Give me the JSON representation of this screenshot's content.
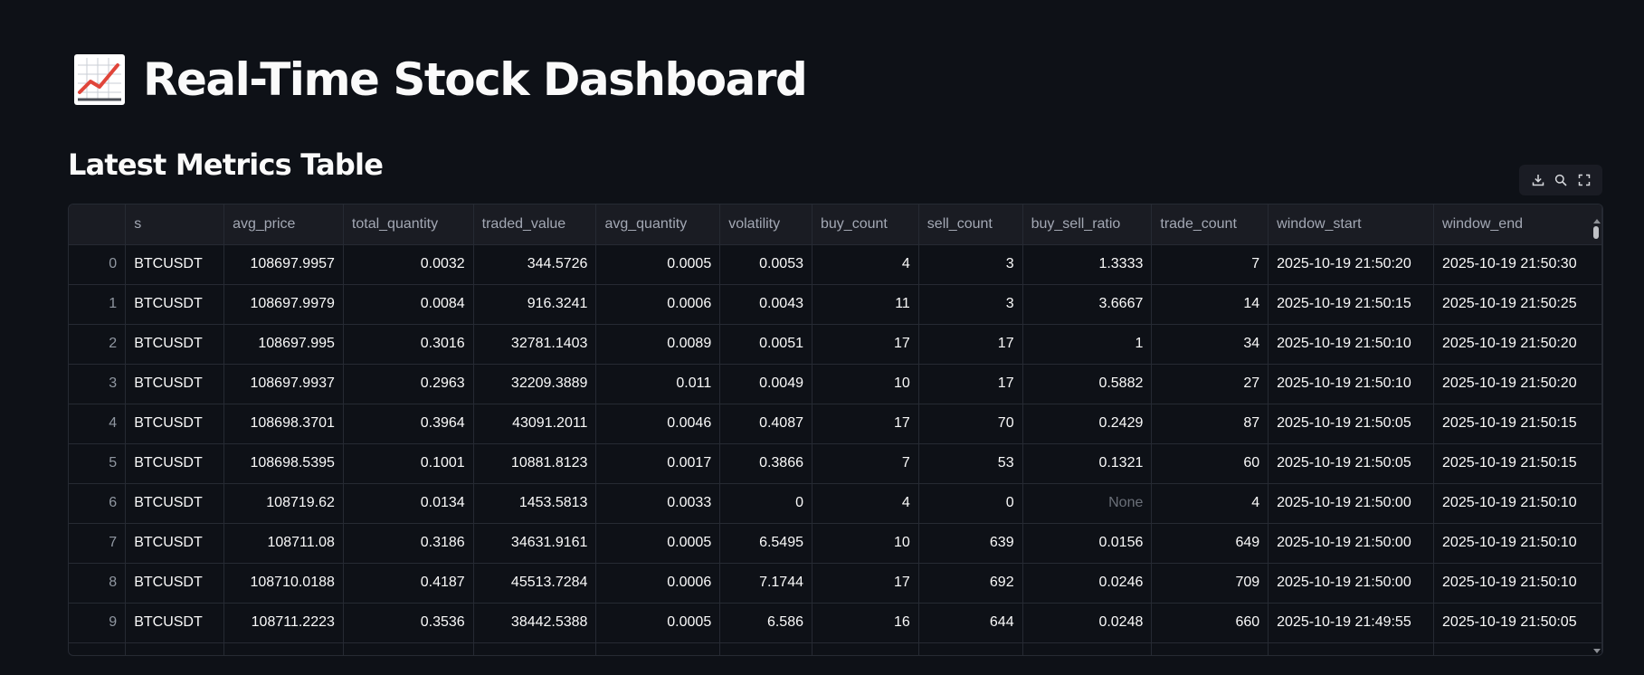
{
  "page": {
    "title": "Real-Time Stock Dashboard",
    "title_icon": "chart-increasing-emoji",
    "section_title": "Latest Metrics Table"
  },
  "toolbar": {
    "download_icon": "download-icon",
    "search_icon": "search-icon",
    "fullscreen_icon": "fullscreen-icon"
  },
  "colors": {
    "background": "#0e1117",
    "header_bg": "#1a1c23",
    "border": "#262a33",
    "text": "#fafafa",
    "muted": "#a3a8b4"
  },
  "table": {
    "columns": [
      "",
      "s",
      "avg_price",
      "total_quantity",
      "traded_value",
      "avg_quantity",
      "volatility",
      "buy_count",
      "sell_count",
      "buy_sell_ratio",
      "trade_count",
      "window_start",
      "window_end"
    ],
    "rows": [
      [
        "0",
        "BTCUSDT",
        "108697.9957",
        "0.0032",
        "344.5726",
        "0.0005",
        "0.0053",
        "4",
        "3",
        "1.3333",
        "7",
        "2025-10-19 21:50:20",
        "2025-10-19 21:50:30"
      ],
      [
        "1",
        "BTCUSDT",
        "108697.9979",
        "0.0084",
        "916.3241",
        "0.0006",
        "0.0043",
        "11",
        "3",
        "3.6667",
        "14",
        "2025-10-19 21:50:15",
        "2025-10-19 21:50:25"
      ],
      [
        "2",
        "BTCUSDT",
        "108697.995",
        "0.3016",
        "32781.1403",
        "0.0089",
        "0.0051",
        "17",
        "17",
        "1",
        "34",
        "2025-10-19 21:50:10",
        "2025-10-19 21:50:20"
      ],
      [
        "3",
        "BTCUSDT",
        "108697.9937",
        "0.2963",
        "32209.3889",
        "0.011",
        "0.0049",
        "10",
        "17",
        "0.5882",
        "27",
        "2025-10-19 21:50:10",
        "2025-10-19 21:50:20"
      ],
      [
        "4",
        "BTCUSDT",
        "108698.3701",
        "0.3964",
        "43091.2011",
        "0.0046",
        "0.4087",
        "17",
        "70",
        "0.2429",
        "87",
        "2025-10-19 21:50:05",
        "2025-10-19 21:50:15"
      ],
      [
        "5",
        "BTCUSDT",
        "108698.5395",
        "0.1001",
        "10881.8123",
        "0.0017",
        "0.3866",
        "7",
        "53",
        "0.1321",
        "60",
        "2025-10-19 21:50:05",
        "2025-10-19 21:50:15"
      ],
      [
        "6",
        "BTCUSDT",
        "108719.62",
        "0.0134",
        "1453.5813",
        "0.0033",
        "0",
        "4",
        "0",
        "None",
        "4",
        "2025-10-19 21:50:00",
        "2025-10-19 21:50:10"
      ],
      [
        "7",
        "BTCUSDT",
        "108711.08",
        "0.3186",
        "34631.9161",
        "0.0005",
        "6.5495",
        "10",
        "639",
        "0.0156",
        "649",
        "2025-10-19 21:50:00",
        "2025-10-19 21:50:10"
      ],
      [
        "8",
        "BTCUSDT",
        "108710.0188",
        "0.4187",
        "45513.7284",
        "0.0006",
        "7.1744",
        "17",
        "692",
        "0.0246",
        "709",
        "2025-10-19 21:50:00",
        "2025-10-19 21:50:10"
      ],
      [
        "9",
        "BTCUSDT",
        "108711.2223",
        "0.3536",
        "38442.5388",
        "0.0005",
        "6.586",
        "16",
        "644",
        "0.0248",
        "660",
        "2025-10-19 21:49:55",
        "2025-10-19 21:50:05"
      ]
    ]
  }
}
